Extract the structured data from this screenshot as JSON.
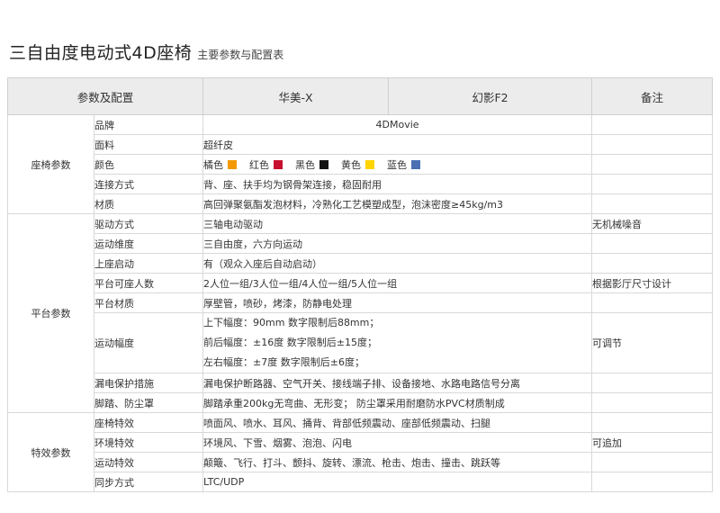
{
  "header": {
    "title": "三自由度电动式4D座椅",
    "subtitle": "主要参数与配置表"
  },
  "table": {
    "columns": [
      "参数及配置",
      "华美-X",
      "幻影F2",
      "备注"
    ],
    "seat": {
      "category": "座椅参数",
      "brand_label": "品牌",
      "brand_value": "4DMovie",
      "fabric_label": "面料",
      "fabric_value": "超纤皮",
      "color_label": "颜色",
      "colors": [
        {
          "name": "橘色",
          "hex": "#f39800"
        },
        {
          "name": "红色",
          "hex": "#c8102e"
        },
        {
          "name": "黑色",
          "hex": "#111111"
        },
        {
          "name": "黄色",
          "hex": "#ffd400"
        },
        {
          "name": "蓝色",
          "hex": "#4a6fb5"
        }
      ],
      "connection_label": "连接方式",
      "connection_value": "背、座、扶手均为钢骨架连接，稳固耐用",
      "material_label": "材质",
      "material_value": "高回弹聚氨酯发泡材料，冷熟化工艺模塑成型，泡沫密度≥45kg/m3"
    },
    "platform": {
      "category": "平台参数",
      "drive_label": "驱动方式",
      "drive_value": "三轴电动驱动",
      "drive_note": "无机械噪音",
      "dof_label": "运动维度",
      "dof_value": "三自由度，六方向运动",
      "start_label": "上座启动",
      "start_value": "有（观众入座后自动启动）",
      "capacity_label": "平台可座人数",
      "capacity_value": "2人位一组/3人位一组/4人位一组/5人位一组",
      "capacity_note": "根据影厅尺寸设计",
      "pmaterial_label": "平台材质",
      "pmaterial_value": "厚壁管，喷砂，烤漆，防静电处理",
      "amplitude_label": "运动幅度",
      "amplitude_lines": [
        "上下幅度：90mm 数字限制后88mm；",
        "前后幅度：±16度 数字限制后±15度；",
        "左右幅度：±7度 数字限制后±6度；"
      ],
      "amplitude_note": "可调节",
      "leak_label": "漏电保护措施",
      "leak_value": "漏电保护断路器、空气开关、接线端子排、设备接地、水路电路信号分离",
      "pedal_label": "脚踏、防尘罩",
      "pedal_value": "脚踏承重200kg无弯曲、无形变；  防尘罩采用耐磨防水PVC材质制成"
    },
    "effects": {
      "category": "特效参数",
      "seat_fx_label": "座椅特效",
      "seat_fx_value": "喷面风、喷水、耳风、捅背、背部低频震动、座部低频震动、扫腿",
      "env_fx_label": "环境特效",
      "env_fx_value": "环境风、下雪、烟雾、泡泡、闪电",
      "env_fx_note": "可追加",
      "motion_fx_label": "运动特效",
      "motion_fx_value": "颠簸、飞行、打斗、颤抖、旋转、漂流、枪击、炮击、撞击、跳跃等",
      "sync_label": "同步方式",
      "sync_value": "LTC/UDP"
    }
  }
}
